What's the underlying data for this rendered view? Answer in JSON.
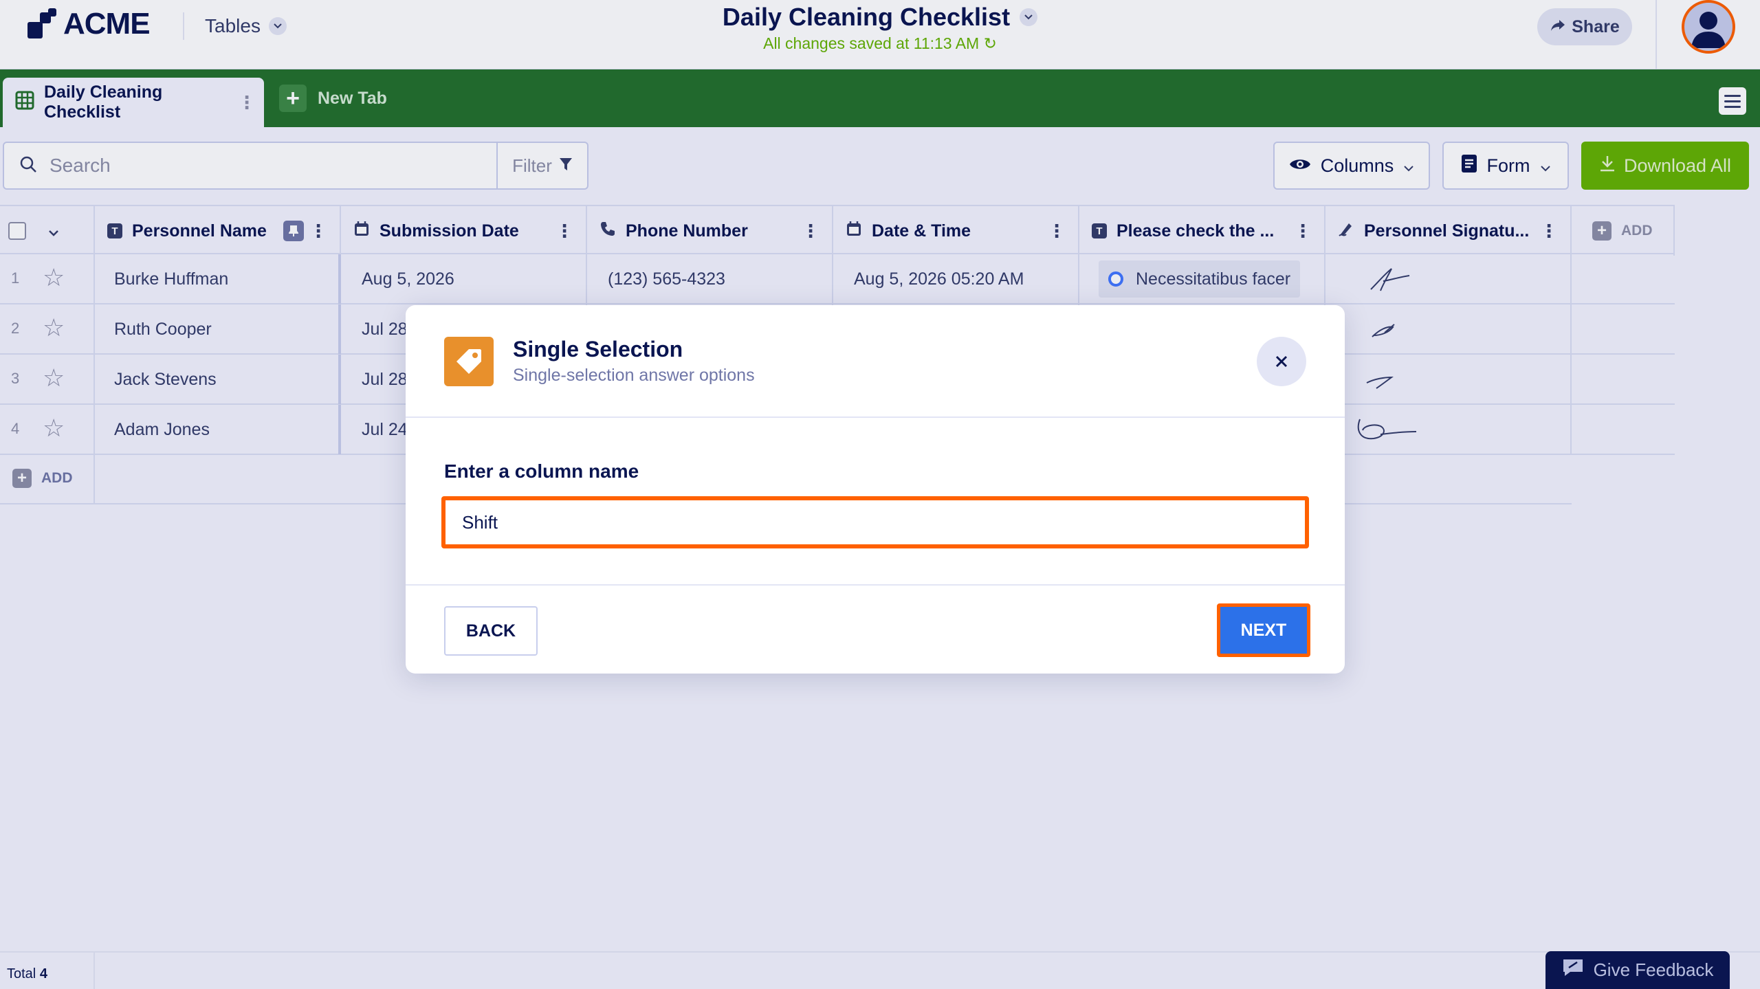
{
  "header": {
    "logo_text": "ACME",
    "tables_label": "Tables",
    "title": "Daily Cleaning Checklist",
    "saved_status": "All changes saved at 11:13 AM",
    "share_label": "Share"
  },
  "tabs": {
    "active_label": "Daily Cleaning Checklist",
    "new_tab_label": "New Tab"
  },
  "toolbar": {
    "search_placeholder": "Search",
    "filter_label": "Filter",
    "columns_label": "Columns",
    "form_label": "Form",
    "download_label": "Download All"
  },
  "table": {
    "columns": [
      {
        "label": "Personnel Name",
        "icon": "text-type-icon"
      },
      {
        "label": "Submission Date",
        "icon": "calendar-icon"
      },
      {
        "label": "Phone Number",
        "icon": "phone-icon"
      },
      {
        "label": "Date & Time",
        "icon": "calendar-icon"
      },
      {
        "label": "Please check the ...",
        "icon": "text-type-icon"
      },
      {
        "label": "Personnel Signatu...",
        "icon": "signature-icon"
      }
    ],
    "add_column_label": "ADD",
    "rows": [
      {
        "num": "1",
        "name": "Burke Huffman",
        "date": "Aug 5, 2026",
        "phone": "(123) 565-4323",
        "datetime": "Aug 5, 2026 05:20 AM",
        "check": "Necessitatibus facer"
      },
      {
        "num": "2",
        "name": "Ruth Cooper",
        "date": "Jul 28",
        "phone": "",
        "datetime": "",
        "check": ""
      },
      {
        "num": "3",
        "name": "Jack Stevens",
        "date": "Jul 28",
        "phone": "",
        "datetime": "",
        "check": ""
      },
      {
        "num": "4",
        "name": "Adam Jones",
        "date": "Jul 24",
        "phone": "",
        "datetime": "",
        "check": ""
      }
    ],
    "add_row_label": "ADD"
  },
  "footer": {
    "total_label": "Total",
    "total_count": "4",
    "feedback_label": "Give Feedback"
  },
  "modal": {
    "title": "Single Selection",
    "subtitle": "Single-selection answer options",
    "field_label": "Enter a column name",
    "input_value": "Shift",
    "back_label": "BACK",
    "next_label": "NEXT"
  },
  "colors": {
    "tabbar_green": "#23702b",
    "download_green": "#64b200",
    "highlight_orange": "#ff6100",
    "next_blue": "#2c71e9",
    "modal_icon_orange": "#e8902c"
  }
}
